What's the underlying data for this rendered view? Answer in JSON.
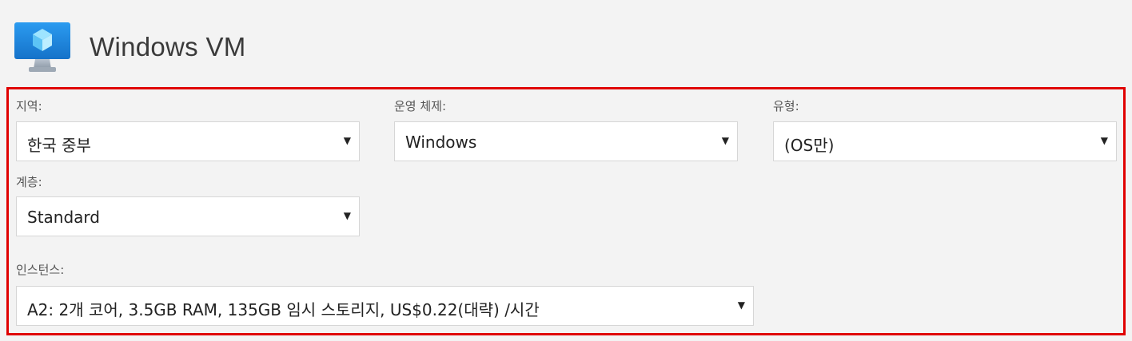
{
  "header": {
    "icon": "virtual-machine-icon",
    "title": "Windows VM"
  },
  "form": {
    "region": {
      "label": "지역:",
      "value": "한국 중부"
    },
    "os": {
      "label": "운영 체제:",
      "value": "Windows"
    },
    "type": {
      "label": "유형:",
      "value": "(OS만)"
    },
    "tier": {
      "label": "계층:",
      "value": "Standard"
    },
    "instance": {
      "label": "인스턴스:",
      "value": "A2: 2개 코어, 3.5GB RAM, 135GB 임시 스토리지, US$0.22(대략) /시간"
    }
  },
  "colors": {
    "highlight_border": "#e00000",
    "icon_blue": "#1e8ce0",
    "background": "#f3f3f3"
  }
}
